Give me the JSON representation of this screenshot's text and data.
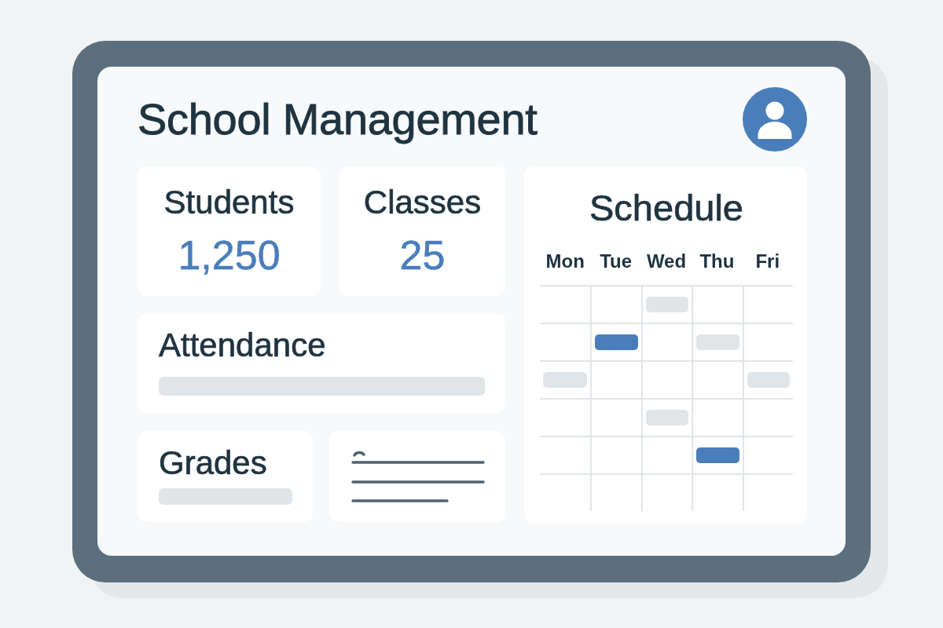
{
  "app": {
    "title": "School Management"
  },
  "stats": [
    {
      "label": "Students",
      "value": "1,250"
    },
    {
      "label": "Classes",
      "value": "25"
    }
  ],
  "attendance": {
    "label": "Attendance"
  },
  "grades": {
    "label": "Grades"
  },
  "schedule": {
    "title": "Schedule",
    "days": [
      "Mon",
      "Tue",
      "Wed",
      "Thu",
      "Fri"
    ],
    "rows": [
      {
        "cells": [
          {
            "kind": "empty"
          },
          {
            "kind": "empty"
          },
          {
            "kind": "event",
            "color": "#e2e5e8"
          },
          {
            "kind": "empty"
          },
          {
            "kind": "empty"
          }
        ]
      },
      {
        "cells": [
          {
            "kind": "empty"
          },
          {
            "kind": "event",
            "color": "#4a7ebb"
          },
          {
            "kind": "empty"
          },
          {
            "kind": "event",
            "color": "#e2e5e8"
          },
          {
            "kind": "empty"
          }
        ]
      },
      {
        "cells": [
          {
            "kind": "event",
            "color": "#e2e5e8"
          },
          {
            "kind": "empty"
          },
          {
            "kind": "empty"
          },
          {
            "kind": "empty"
          },
          {
            "kind": "event",
            "color": "#e2e5e8"
          }
        ]
      },
      {
        "cells": [
          {
            "kind": "empty"
          },
          {
            "kind": "empty"
          },
          {
            "kind": "event",
            "color": "#e2e5e8"
          },
          {
            "kind": "empty"
          },
          {
            "kind": "empty"
          }
        ]
      },
      {
        "cells": [
          {
            "kind": "empty"
          },
          {
            "kind": "empty"
          },
          {
            "kind": "empty"
          },
          {
            "kind": "event",
            "color": "#4a7ebb"
          },
          {
            "kind": "empty"
          }
        ]
      },
      {
        "cells": [
          {
            "kind": "empty"
          },
          {
            "kind": "empty"
          },
          {
            "kind": "empty"
          },
          {
            "kind": "empty"
          },
          {
            "kind": "empty"
          }
        ]
      }
    ]
  }
}
